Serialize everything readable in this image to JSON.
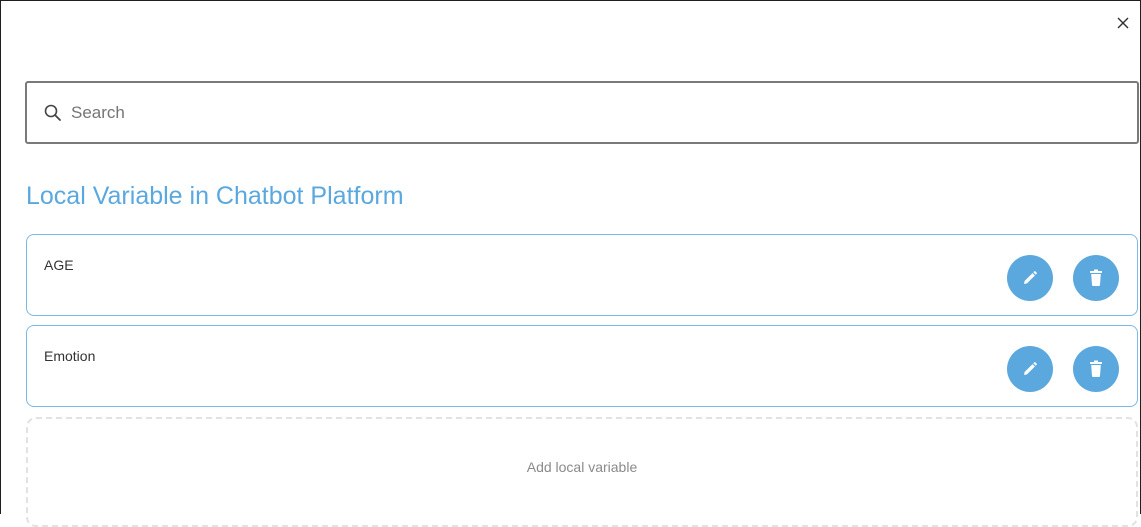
{
  "dialog": {
    "close_icon": "close-icon"
  },
  "search": {
    "placeholder": "Search",
    "value": "",
    "icon": "search-icon"
  },
  "section": {
    "title": "Local Variable in Chatbot Platform"
  },
  "variables": [
    {
      "name": "AGE",
      "edit_icon": "pencil-icon",
      "delete_icon": "trash-icon"
    },
    {
      "name": "Emotion",
      "edit_icon": "pencil-icon",
      "delete_icon": "trash-icon"
    }
  ],
  "add_variable": {
    "label": "Add local variable"
  },
  "colors": {
    "accent": "#5ba8df",
    "card_border": "#7ab8e8",
    "dashed_border": "#e2e2e2",
    "search_border": "#7a7a7a"
  }
}
